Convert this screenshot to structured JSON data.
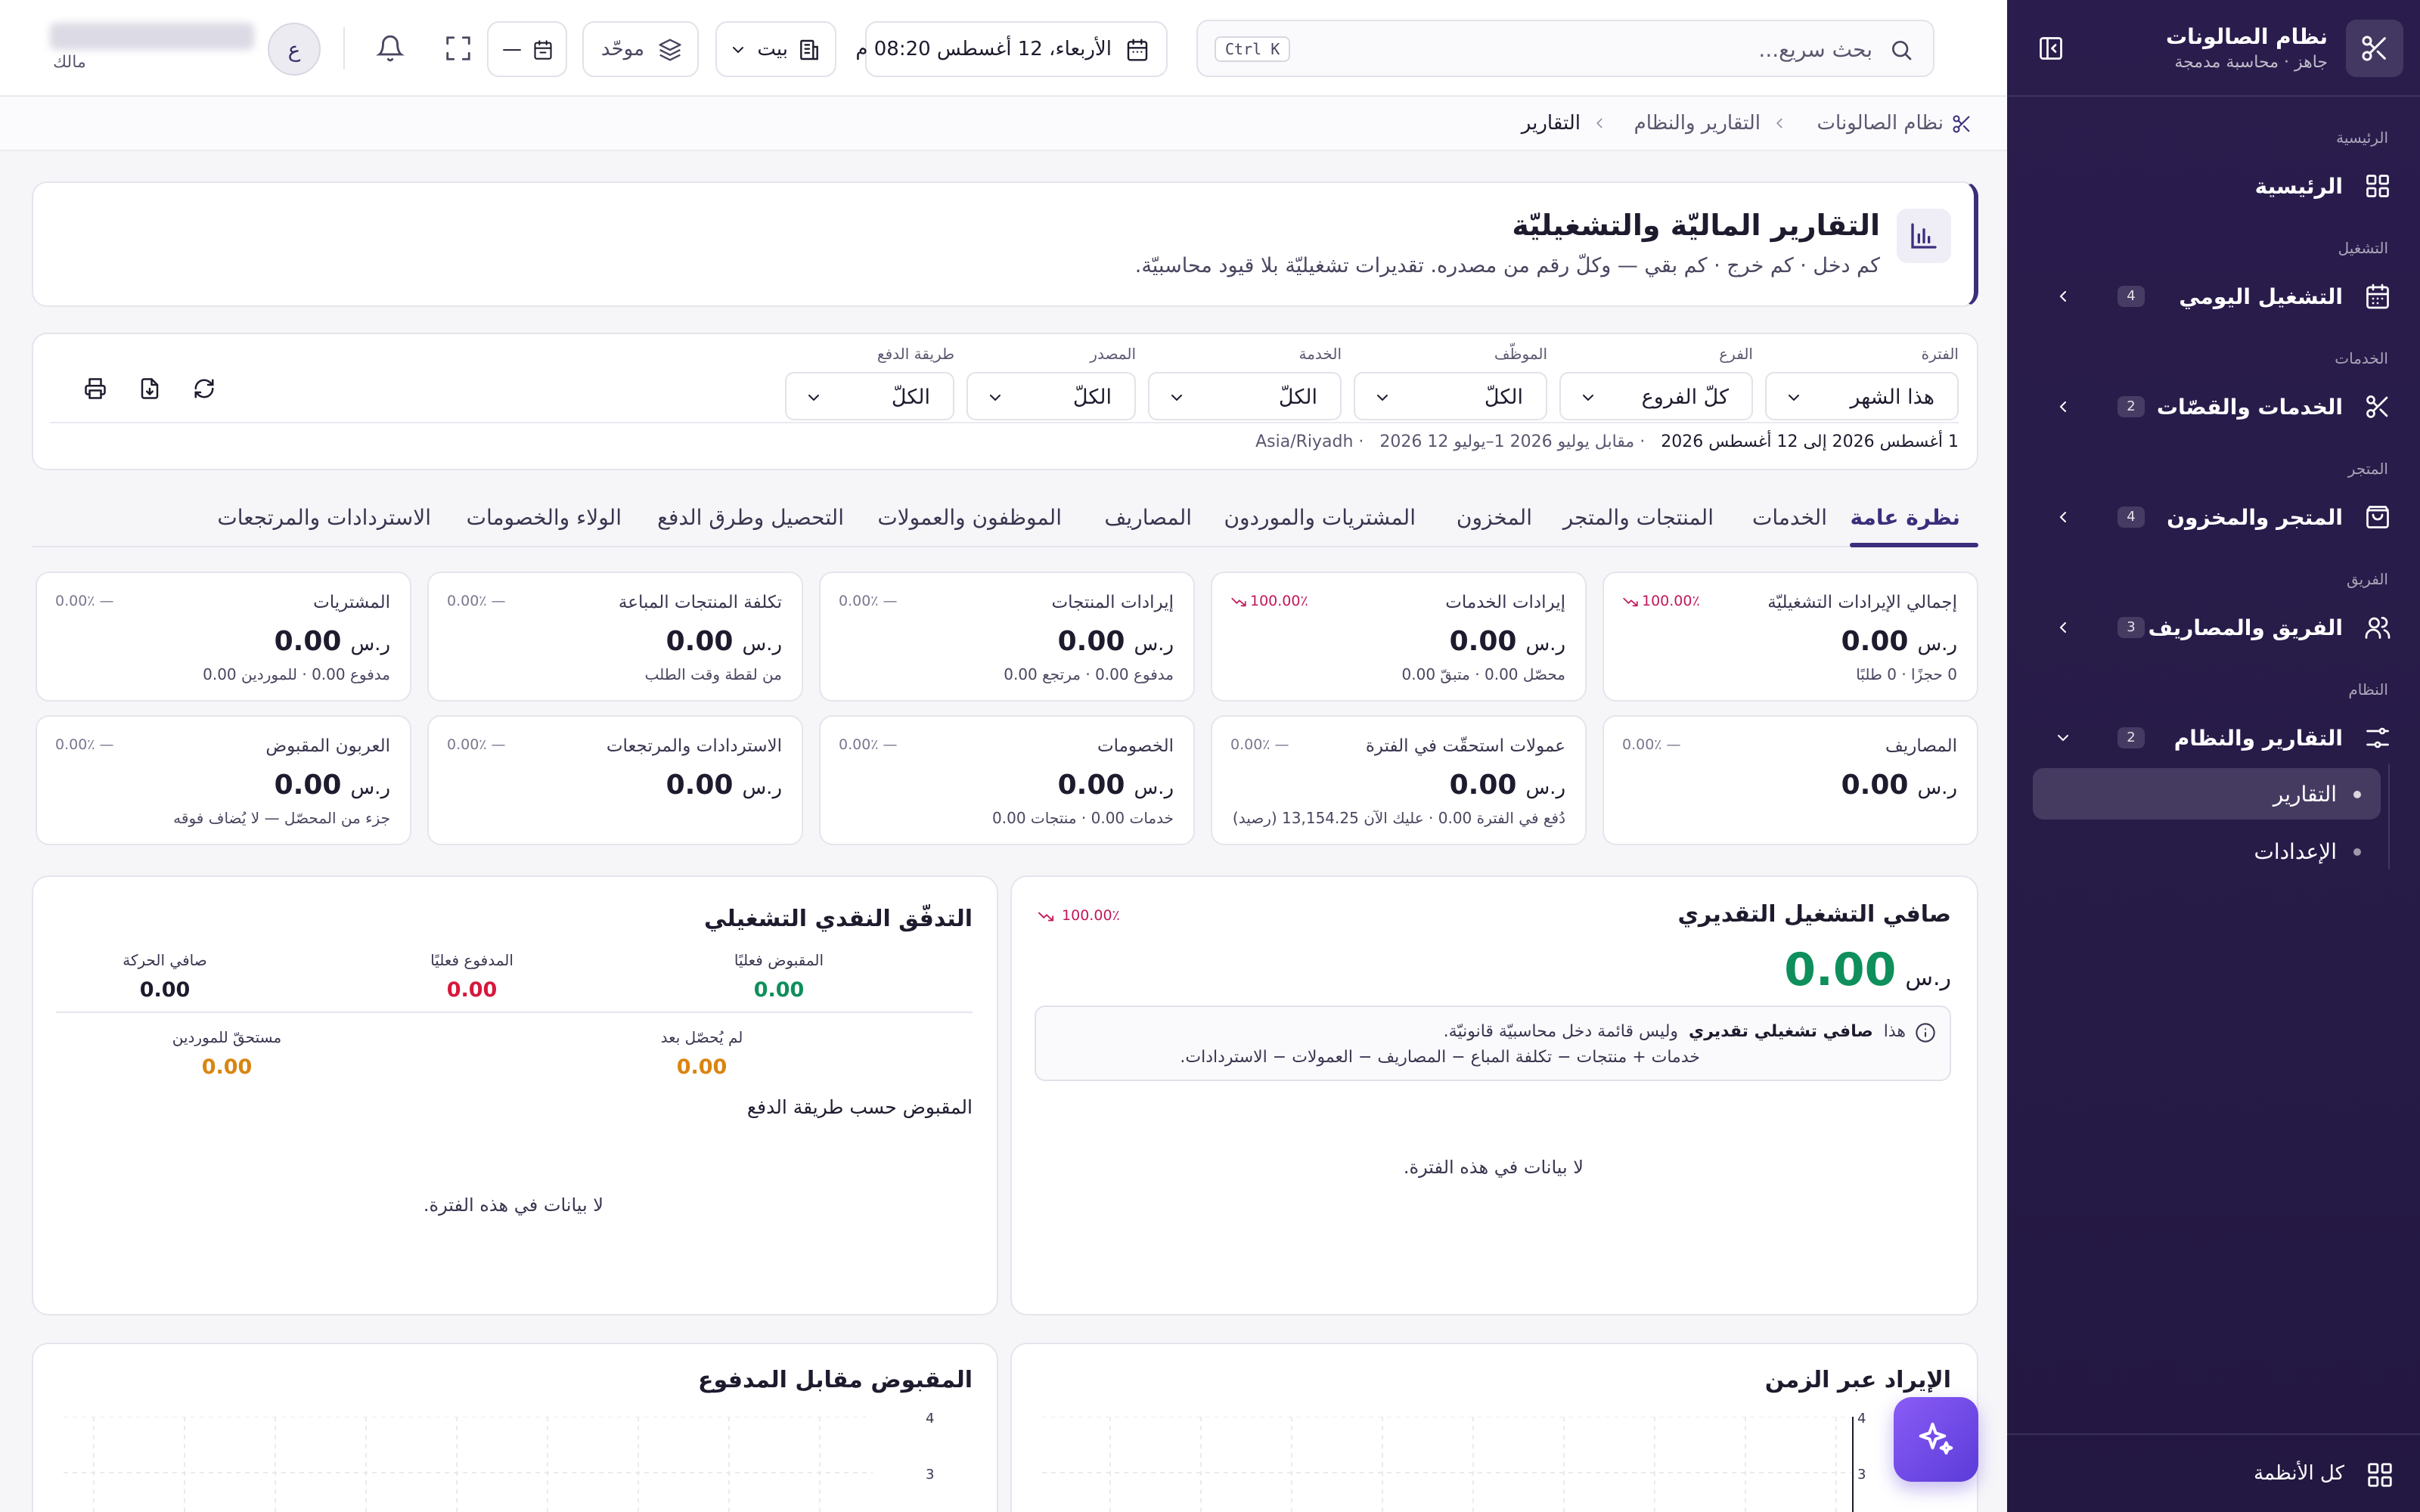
{
  "app": {
    "name": "نظام الصالونات",
    "status": "جاهز · محاسبة مدمجة"
  },
  "sidebar": {
    "sections": {
      "home": "الرئيسية",
      "operation": "التشغيل",
      "services": "الخدمات",
      "store": "المتجر",
      "team": "الفريق",
      "system": "النظام"
    },
    "items": [
      {
        "label": "الرئيسية",
        "icon": "grid-icon"
      },
      {
        "label": "التشغيل اليومي",
        "badge": "4",
        "icon": "calendar-icon"
      },
      {
        "label": "الخدمات والقصّات",
        "badge": "2",
        "icon": "scissors-icon"
      },
      {
        "label": "المتجر والمخزون",
        "badge": "4",
        "icon": "shopping-bag-icon"
      },
      {
        "label": "الفريق والمصاريف",
        "badge": "3",
        "icon": "users-icon"
      },
      {
        "label": "التقارير والنظام",
        "badge": "2",
        "icon": "sliders-icon"
      }
    ],
    "subitems": [
      {
        "label": "التقارير",
        "active": true
      },
      {
        "label": "الإعدادات",
        "active": false
      }
    ],
    "footer": "كل الأنظمة"
  },
  "topbar": {
    "search_placeholder": "بحث سريع...",
    "shortcut": "Ctrl K",
    "datetime": "الأربعاء، 12 أغسطس 08:20 م",
    "branch": "بيت",
    "unified": "موحّد",
    "calendar_value": "—",
    "avatar_letter": "ع",
    "user_role": "مالك"
  },
  "breadcrumb": {
    "root": "نظام الصالونات",
    "section": "التقارير والنظام",
    "current": "التقارير"
  },
  "page": {
    "title": "التقارير الماليّة والتشغيليّة",
    "subtitle": "كم دخل · كم خرج · كم بقي — وكلّ رقم من مصدره. تقديرات تشغيليّة بلا قيود محاسبيّة."
  },
  "filters": {
    "period": {
      "label": "الفترة",
      "value": "هذا الشهر"
    },
    "branch": {
      "label": "الفرع",
      "value": "كلّ الفروع"
    },
    "employee": {
      "label": "الموظّف",
      "value": "الكلّ"
    },
    "service": {
      "label": "الخدمة",
      "value": "الكلّ"
    },
    "source": {
      "label": "المصدر",
      "value": "الكلّ"
    },
    "payment": {
      "label": "طريقة الدفع",
      "value": "الكلّ"
    },
    "range_main": "1 أغسطس 2026 إلى 12 أغسطس 2026",
    "range_compare": "· مقابل يوليو 2026 1–يوليو 12 2026",
    "timezone": "· Asia/Riyadh"
  },
  "tabs": [
    "نظرة عامة",
    "الخدمات",
    "المنتجات والمتجر",
    "المخزون",
    "المشتريات والموردون",
    "المصاريف",
    "الموظفون والعمولات",
    "التحصيل وطرق الدفع",
    "الولاء والخصومات",
    "الاستردادات والمرتجعات"
  ],
  "currency": "ر.س",
  "kpis": [
    {
      "title": "إجمالي الإيرادات التشغيليّة",
      "value": "0.00",
      "delta": "100.00٪",
      "trend": "down",
      "sub": "0 حجزًا · 0 طلبًا"
    },
    {
      "title": "إيرادات الخدمات",
      "value": "0.00",
      "delta": "100.00٪",
      "trend": "down",
      "sub": "محصّل 0.00 · متبقّ 0.00"
    },
    {
      "title": "إيرادات المنتجات",
      "value": "0.00",
      "delta": "— 0.00٪",
      "trend": "flat",
      "sub": "مدفوع 0.00 · مرتجع 0.00"
    },
    {
      "title": "تكلفة المنتجات المباعة",
      "value": "0.00",
      "delta": "— 0.00٪",
      "trend": "flat",
      "sub": "من لقطة وقت الطلب"
    },
    {
      "title": "المشتريات",
      "value": "0.00",
      "delta": "— 0.00٪",
      "trend": "flat",
      "sub": "مدفوع 0.00 · للموردين 0.00"
    },
    {
      "title": "المصاريف",
      "value": "0.00",
      "delta": "— 0.00٪",
      "trend": "flat",
      "sub": ""
    },
    {
      "title": "عمولات استحقّت في الفترة",
      "value": "0.00",
      "delta": "— 0.00٪",
      "trend": "flat",
      "sub": "دُفع في الفترة 0.00 · عليك الآن 13,154.25 (رصيد)"
    },
    {
      "title": "الخصومات",
      "value": "0.00",
      "delta": "— 0.00٪",
      "trend": "flat",
      "sub": "خدمات 0.00 · منتجات 0.00"
    },
    {
      "title": "الاستردادات والمرتجعات",
      "value": "0.00",
      "delta": "— 0.00٪",
      "trend": "flat",
      "sub": ""
    },
    {
      "title": "العربون المقبوض",
      "value": "0.00",
      "delta": "— 0.00٪",
      "trend": "flat",
      "sub": "جزء من المحصّل — لا يُضاف فوقه"
    }
  ],
  "net": {
    "title": "صافي التشغيل التقديري",
    "value": "0.00",
    "delta": "100.00٪",
    "note_prefix": "هذا",
    "note_bold": "صافي تشغيلي تقديري",
    "note_rest": "وليس قائمة دخل محاسبيّة قانونيّة.",
    "note_formula": "خدمات + منتجات − تكلفة المباع − المصاريف − العمولات − الاستردادات.",
    "empty": "لا بيانات في هذه الفترة."
  },
  "cashflow": {
    "title": "التدفّق النقدي التشغيلي",
    "received": {
      "label": "المقبوض فعليًا",
      "value": "0.00",
      "color": "#0e8f5b"
    },
    "paid": {
      "label": "المدفوع فعليًا",
      "value": "0.00",
      "color": "#d6183c"
    },
    "net_move": {
      "label": "صافي الحركة",
      "value": "0.00",
      "color": "#1e1b2e"
    },
    "not_collected": {
      "label": "لم يُحصّل بعد",
      "value": "0.00",
      "color": "#d98512"
    },
    "due_suppliers": {
      "label": "مستحقّ للموردين",
      "value": "0.00",
      "color": "#d98512"
    },
    "by_method_title": "المقبوض حسب طريقة الدفع",
    "empty": "لا بيانات في هذه الفترة."
  },
  "charts": {
    "revenue_title": "الإيراد عبر الزمن",
    "cash_title": "المقبوض مقابل المدفوع",
    "y_ticks": [
      "4",
      "3"
    ]
  }
}
